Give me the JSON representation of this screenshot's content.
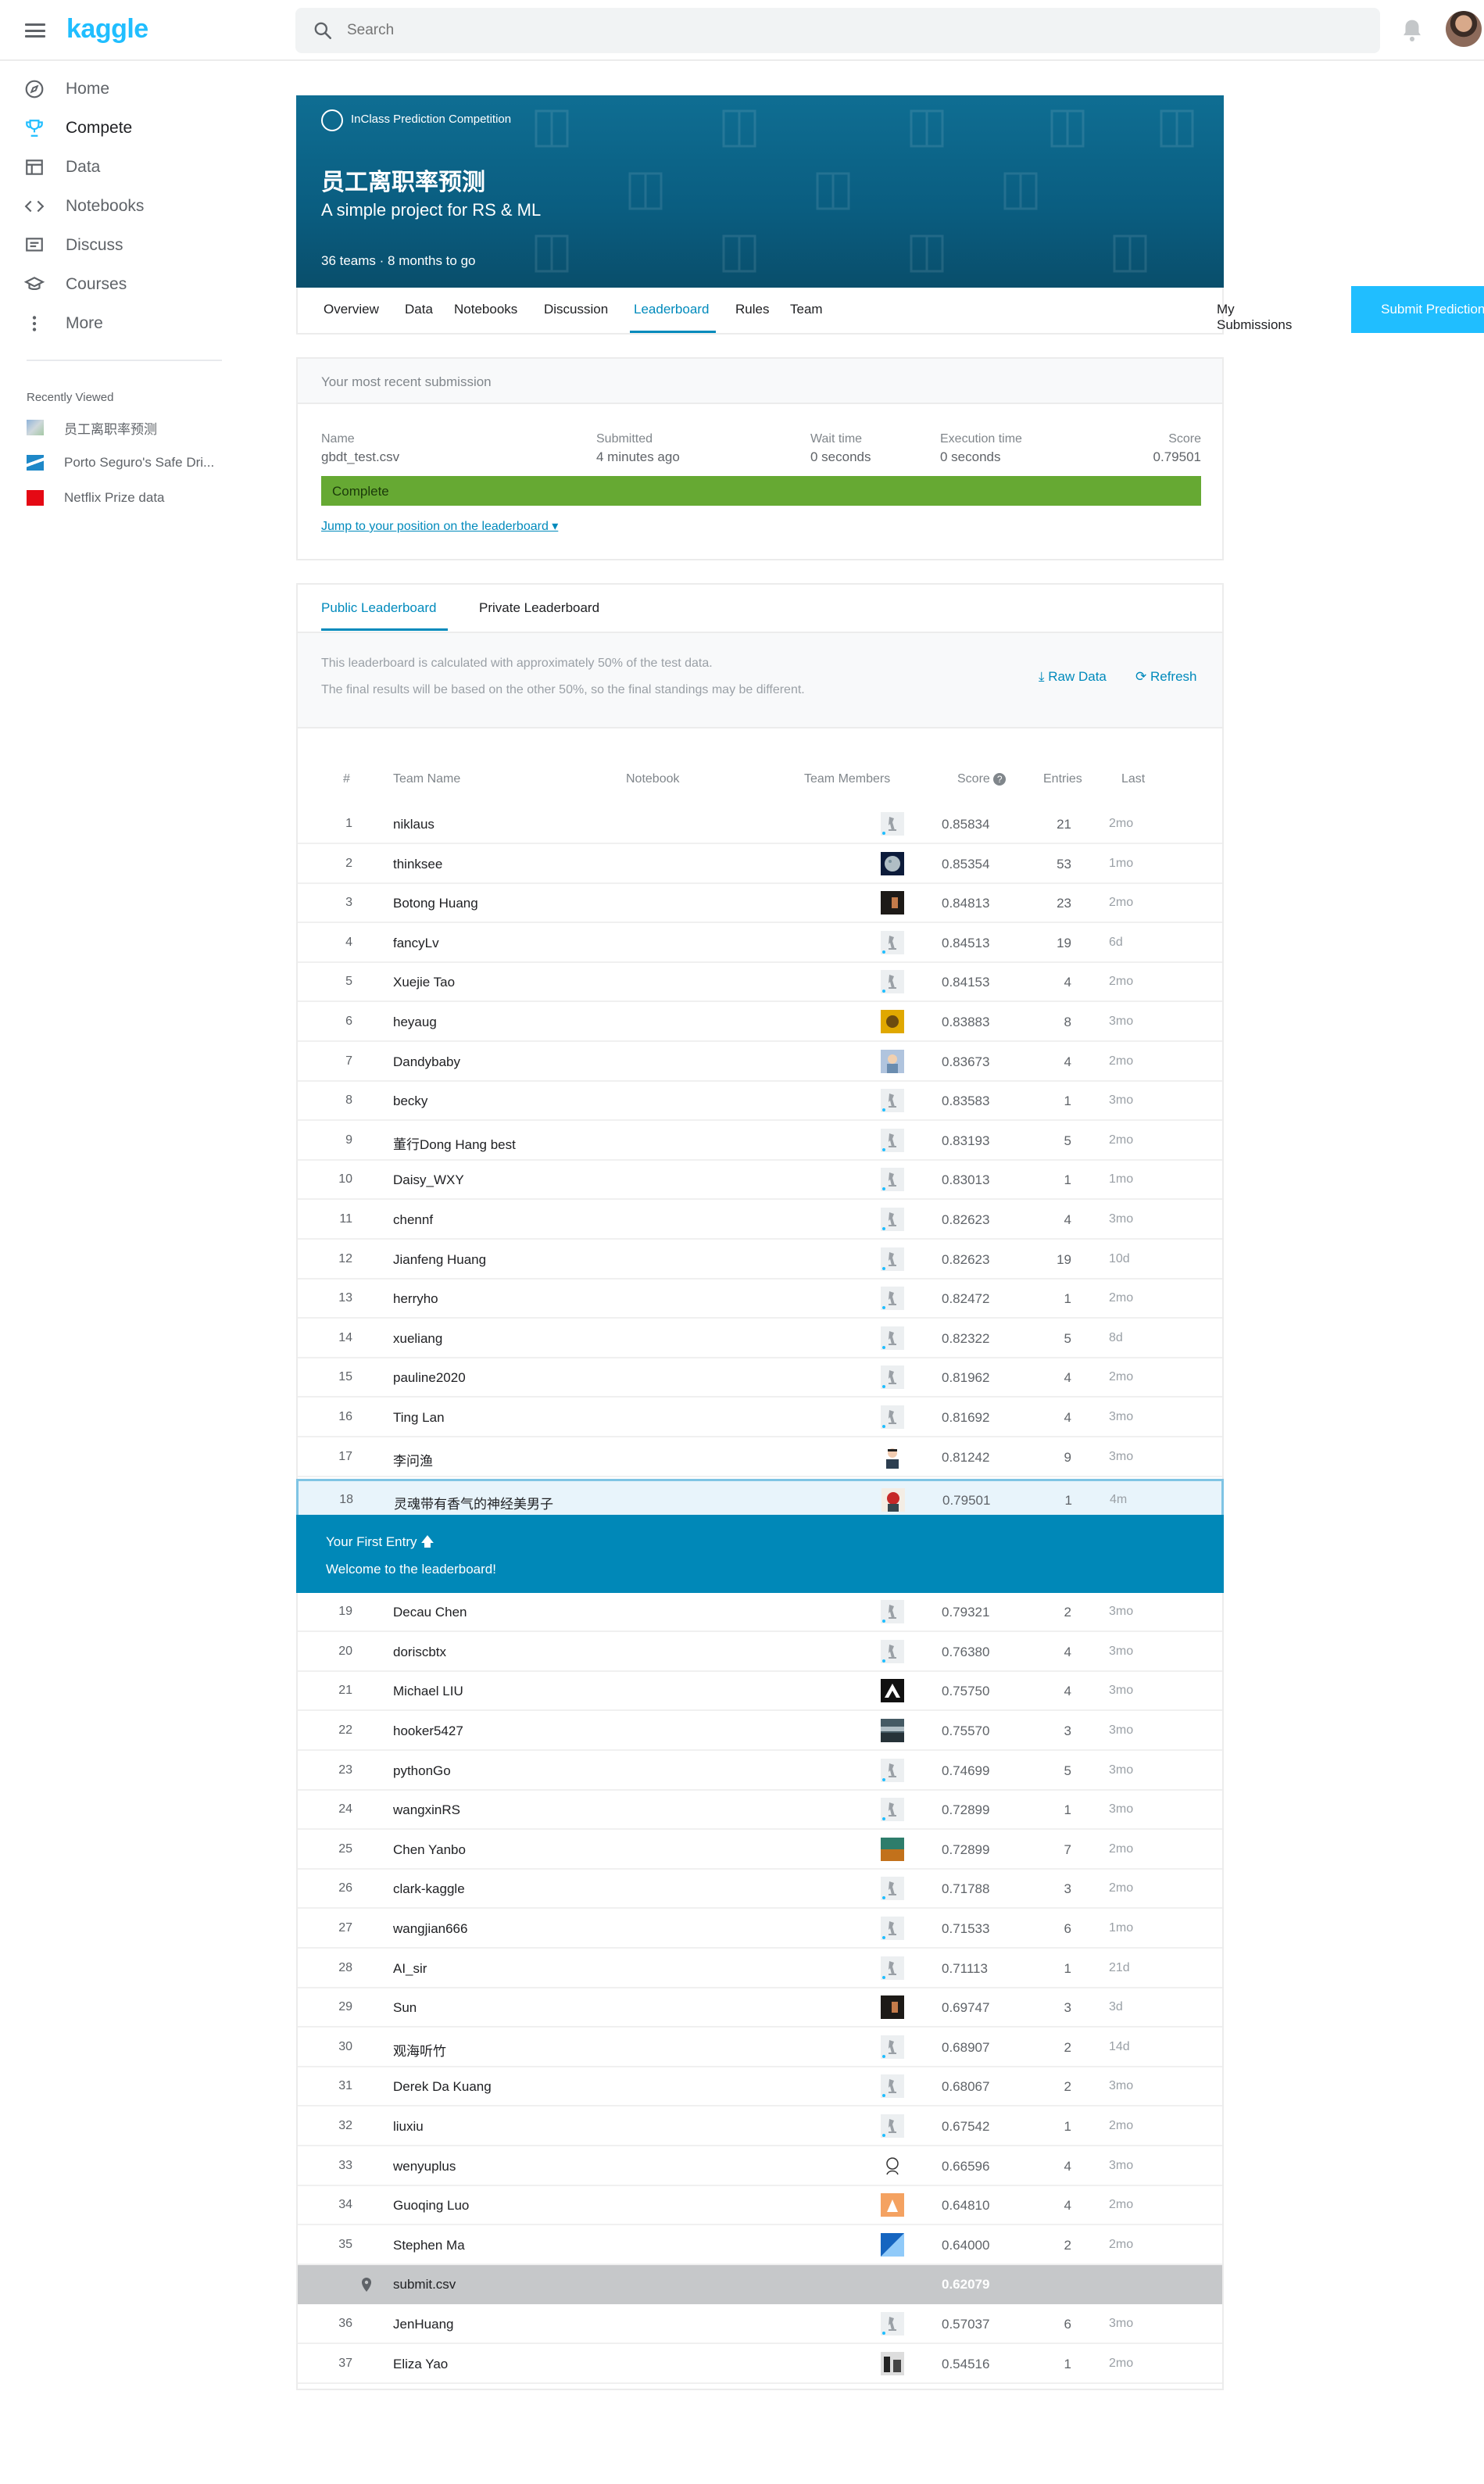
{
  "header": {
    "logo": "kaggle",
    "search_placeholder": "Search"
  },
  "sidebar": {
    "items": [
      {
        "label": "Home",
        "icon": "compass-icon"
      },
      {
        "label": "Compete",
        "icon": "trophy-icon"
      },
      {
        "label": "Data",
        "icon": "table-icon"
      },
      {
        "label": "Notebooks",
        "icon": "code-icon"
      },
      {
        "label": "Discuss",
        "icon": "discussion-icon"
      },
      {
        "label": "Courses",
        "icon": "graduation-cap-icon"
      },
      {
        "label": "More",
        "icon": "more-vertical-icon"
      }
    ],
    "recent_title": "Recently Viewed",
    "recent": [
      {
        "label": "员工离职率预测"
      },
      {
        "label": "Porto Seguro's Safe Dri..."
      },
      {
        "label": "Netflix Prize data"
      }
    ]
  },
  "competition": {
    "badge": "InClass Prediction Competition",
    "title": "员工离职率预测",
    "subtitle": "A simple project for RS & ML",
    "meta": "36 teams  ·  8 months to go",
    "tabs": [
      "Overview",
      "Data",
      "Notebooks",
      "Discussion",
      "Leaderboard",
      "Rules",
      "Team"
    ],
    "my_submissions": "My Submissions",
    "submit_predictions": "Submit Predictions"
  },
  "submission": {
    "heading": "Your most recent submission",
    "labels": {
      "name": "Name",
      "submitted": "Submitted",
      "wait": "Wait time",
      "exec": "Execution time",
      "score": "Score"
    },
    "values": {
      "name": "gbdt_test.csv",
      "submitted": "4 minutes ago",
      "wait": "0 seconds",
      "exec": "0 seconds",
      "score": "0.79501"
    },
    "status": "Complete",
    "jump_link": "Jump to your position on the leaderboard ▾"
  },
  "leaderboard": {
    "tabs": [
      "Public Leaderboard",
      "Private Leaderboard"
    ],
    "info_line1": "This leaderboard is calculated with approximately 50% of the test data.",
    "info_line2": "The final results will be based on the other 50%, so the final standings may be different.",
    "raw_data": "Raw Data",
    "refresh": "Refresh",
    "columns": {
      "rank": "#",
      "team": "Team Name",
      "notebook": "Notebook",
      "members": "Team Members",
      "score": "Score",
      "entries": "Entries",
      "last": "Last"
    },
    "first_entry_title": "Your First Entry",
    "first_entry_msg": "Welcome to the leaderboard!",
    "rows_top": [
      {
        "rank": "1",
        "team": "niklaus",
        "score": "0.85834",
        "entries": "21",
        "last": "2mo",
        "avatar": "default"
      },
      {
        "rank": "2",
        "team": "thinksee",
        "score": "0.85354",
        "entries": "53",
        "last": "1mo",
        "avatar": "moon"
      },
      {
        "rank": "3",
        "team": "Botong Huang",
        "score": "0.84813",
        "entries": "23",
        "last": "2mo",
        "avatar": "dark"
      },
      {
        "rank": "4",
        "team": "fancyLv",
        "score": "0.84513",
        "entries": "19",
        "last": "6d",
        "avatar": "default"
      },
      {
        "rank": "5",
        "team": "Xuejie Tao",
        "score": "0.84153",
        "entries": "4",
        "last": "2mo",
        "avatar": "default"
      },
      {
        "rank": "6",
        "team": "heyaug",
        "score": "0.83883",
        "entries": "8",
        "last": "3mo",
        "avatar": "yellow"
      },
      {
        "rank": "7",
        "team": "Dandybaby",
        "score": "0.83673",
        "entries": "4",
        "last": "2mo",
        "avatar": "photo"
      },
      {
        "rank": "8",
        "team": "becky",
        "score": "0.83583",
        "entries": "1",
        "last": "3mo",
        "avatar": "default"
      },
      {
        "rank": "9",
        "team": "董行Dong Hang best",
        "score": "0.83193",
        "entries": "5",
        "last": "2mo",
        "avatar": "default"
      },
      {
        "rank": "10",
        "team": "Daisy_WXY",
        "score": "0.83013",
        "entries": "1",
        "last": "1mo",
        "avatar": "default"
      },
      {
        "rank": "11",
        "team": "chennf",
        "score": "0.82623",
        "entries": "4",
        "last": "3mo",
        "avatar": "default"
      },
      {
        "rank": "12",
        "team": "Jianfeng Huang",
        "score": "0.82623",
        "entries": "19",
        "last": "10d",
        "avatar": "default"
      },
      {
        "rank": "13",
        "team": "herryho",
        "score": "0.82472",
        "entries": "1",
        "last": "2mo",
        "avatar": "default"
      },
      {
        "rank": "14",
        "team": "xueliang",
        "score": "0.82322",
        "entries": "5",
        "last": "8d",
        "avatar": "default"
      },
      {
        "rank": "15",
        "team": "pauline2020",
        "score": "0.81962",
        "entries": "4",
        "last": "2mo",
        "avatar": "default"
      },
      {
        "rank": "16",
        "team": "Ting Lan",
        "score": "0.81692",
        "entries": "4",
        "last": "3mo",
        "avatar": "default"
      },
      {
        "rank": "17",
        "team": "李问渔",
        "score": "0.81242",
        "entries": "9",
        "last": "3mo",
        "avatar": "person"
      }
    ],
    "row_mine": {
      "rank": "18",
      "team": "灵魂带有香气的神经美男子",
      "score": "0.79501",
      "entries": "1",
      "last": "4m",
      "avatar": "cartoon"
    },
    "rows_bottom": [
      {
        "rank": "19",
        "team": "Decau Chen",
        "score": "0.79321",
        "entries": "2",
        "last": "3mo",
        "avatar": "default"
      },
      {
        "rank": "20",
        "team": "doriscbtx",
        "score": "0.76380",
        "entries": "4",
        "last": "3mo",
        "avatar": "default"
      },
      {
        "rank": "21",
        "team": "Michael LIU",
        "score": "0.75750",
        "entries": "4",
        "last": "3mo",
        "avatar": "black"
      },
      {
        "rank": "22",
        "team": "hooker5427",
        "score": "0.75570",
        "entries": "3",
        "last": "3mo",
        "avatar": "landscape"
      },
      {
        "rank": "23",
        "team": "pythonGo",
        "score": "0.74699",
        "entries": "5",
        "last": "3mo",
        "avatar": "default"
      },
      {
        "rank": "24",
        "team": "wangxinRS",
        "score": "0.72899",
        "entries": "1",
        "last": "3mo",
        "avatar": "default"
      },
      {
        "rank": "25",
        "team": "Chen Yanbo",
        "score": "0.72899",
        "entries": "7",
        "last": "2mo",
        "avatar": "green"
      },
      {
        "rank": "26",
        "team": "clark-kaggle",
        "score": "0.71788",
        "entries": "3",
        "last": "2mo",
        "avatar": "default"
      },
      {
        "rank": "27",
        "team": "wangjian666",
        "score": "0.71533",
        "entries": "6",
        "last": "1mo",
        "avatar": "default"
      },
      {
        "rank": "28",
        "team": "AI_sir",
        "score": "0.71113",
        "entries": "1",
        "last": "21d",
        "avatar": "default"
      },
      {
        "rank": "29",
        "team": "Sun",
        "score": "0.69747",
        "entries": "3",
        "last": "3d",
        "avatar": "dark"
      },
      {
        "rank": "30",
        "team": "观海听竹",
        "score": "0.68907",
        "entries": "2",
        "last": "14d",
        "avatar": "default"
      },
      {
        "rank": "31",
        "team": "Derek Da Kuang",
        "score": "0.68067",
        "entries": "2",
        "last": "3mo",
        "avatar": "default"
      },
      {
        "rank": "32",
        "team": "liuxiu",
        "score": "0.67542",
        "entries": "1",
        "last": "2mo",
        "avatar": "default"
      },
      {
        "rank": "33",
        "team": "wenyuplus",
        "score": "0.66596",
        "entries": "4",
        "last": "3mo",
        "avatar": "sketch"
      },
      {
        "rank": "34",
        "team": "Guoqing Luo",
        "score": "0.64810",
        "entries": "4",
        "last": "2mo",
        "avatar": "orange"
      },
      {
        "rank": "35",
        "team": "Stephen Ma",
        "score": "0.64000",
        "entries": "2",
        "last": "2mo",
        "avatar": "blue"
      }
    ],
    "row_position": {
      "team": "submit.csv",
      "score": "0.62079"
    },
    "rows_end": [
      {
        "rank": "36",
        "team": "JenHuang",
        "score": "0.57037",
        "entries": "6",
        "last": "3mo",
        "avatar": "default"
      },
      {
        "rank": "37",
        "team": "Eliza Yao",
        "score": "0.54516",
        "entries": "1",
        "last": "2mo",
        "avatar": "bw"
      }
    ]
  },
  "colors": {
    "kaggle_blue": "#20beff",
    "link": "#008abc",
    "complete": "#66a933",
    "banner": "#0a5d80",
    "first_entry": "#0088b8"
  }
}
